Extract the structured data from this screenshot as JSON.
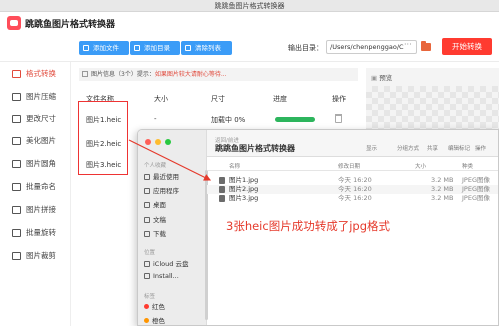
{
  "window": {
    "title": "跳跳鱼图片格式转换器"
  },
  "header": {
    "app_name": "跳跳鱼图片格式转换器",
    "add_file": "添加文件",
    "add_dir": "添加目录",
    "clear_list": "清除列表",
    "output_label": "输出目录：",
    "output_path": "/Users/chenpenggao/C",
    "start": "开始转换"
  },
  "sidebar": {
    "items": [
      {
        "label": "格式转换",
        "icon": "format-convert-icon"
      },
      {
        "label": "图片压缩",
        "icon": "compress-icon"
      },
      {
        "label": "更改尺寸",
        "icon": "resize-icon"
      },
      {
        "label": "美化图片",
        "icon": "beautify-icon"
      },
      {
        "label": "图片圆角",
        "icon": "round-corner-icon"
      },
      {
        "label": "批量命名",
        "icon": "rename-icon"
      },
      {
        "label": "图片拼接",
        "icon": "stitch-icon"
      },
      {
        "label": "批量旋转",
        "icon": "rotate-icon"
      },
      {
        "label": "图片裁剪",
        "icon": "crop-icon"
      }
    ]
  },
  "main": {
    "info_prefix": "图片信息（3个）提示：",
    "info_warn": "如果图片较大请耐心等待...",
    "columns": [
      "文件名称",
      "大小",
      "尺寸",
      "进度",
      "操作"
    ],
    "files": [
      {
        "name": "图片1.heic",
        "size": "-",
        "dims": "加载中 0%",
        "progress": 1
      },
      {
        "name": "图片2.heic",
        "size": "",
        "dims": "",
        "progress": null
      },
      {
        "name": "图片3.heic",
        "size": "",
        "dims": "",
        "progress": null
      }
    ],
    "preview_label": "预览"
  },
  "finder": {
    "breadcrumb": "返回/前进",
    "title": "跳跳鱼图片格式转换器",
    "toolbar": [
      "显示",
      "分组方式",
      "共享",
      "编辑标记",
      "操作"
    ],
    "sidebar": {
      "fav_label": "个人收藏",
      "favorites": [
        {
          "label": "最近使用",
          "icon": "clock-icon"
        },
        {
          "label": "应用程序",
          "icon": "apps-icon"
        },
        {
          "label": "桌面",
          "icon": "desktop-icon"
        },
        {
          "label": "文稿",
          "icon": "document-icon"
        },
        {
          "label": "下载",
          "icon": "download-icon"
        }
      ],
      "loc_label": "位置",
      "locations": [
        {
          "label": "iCloud 云盘",
          "icon": "cloud-icon"
        },
        {
          "label": "Install...",
          "icon": "disk-icon"
        }
      ],
      "tags_label": "标签",
      "tags": [
        {
          "label": "红色",
          "color": "#ff3b30"
        },
        {
          "label": "橙色",
          "color": "#ff9500"
        }
      ]
    },
    "columns": [
      "名称",
      "修改日期",
      "大小",
      "种类"
    ],
    "files": [
      {
        "name": "图片1.jpg",
        "date": "今天 16:20",
        "size": "3.2 MB",
        "kind": "JPEG图像"
      },
      {
        "name": "图片2.jpg",
        "date": "今天 16:20",
        "size": "3.2 MB",
        "kind": "JPEG图像"
      },
      {
        "name": "图片3.jpg",
        "date": "今天 16:20",
        "size": "3.2 MB",
        "kind": "JPEG图像"
      }
    ]
  },
  "annotation": {
    "text": "3张heic图片成功转成了jpg格式",
    "color": "#e53a2c"
  },
  "colors": {
    "accent": "#e14a3c",
    "primary_button": "#3b9cf7",
    "start_button": "#ff3b30",
    "progress": "#2db55d"
  }
}
